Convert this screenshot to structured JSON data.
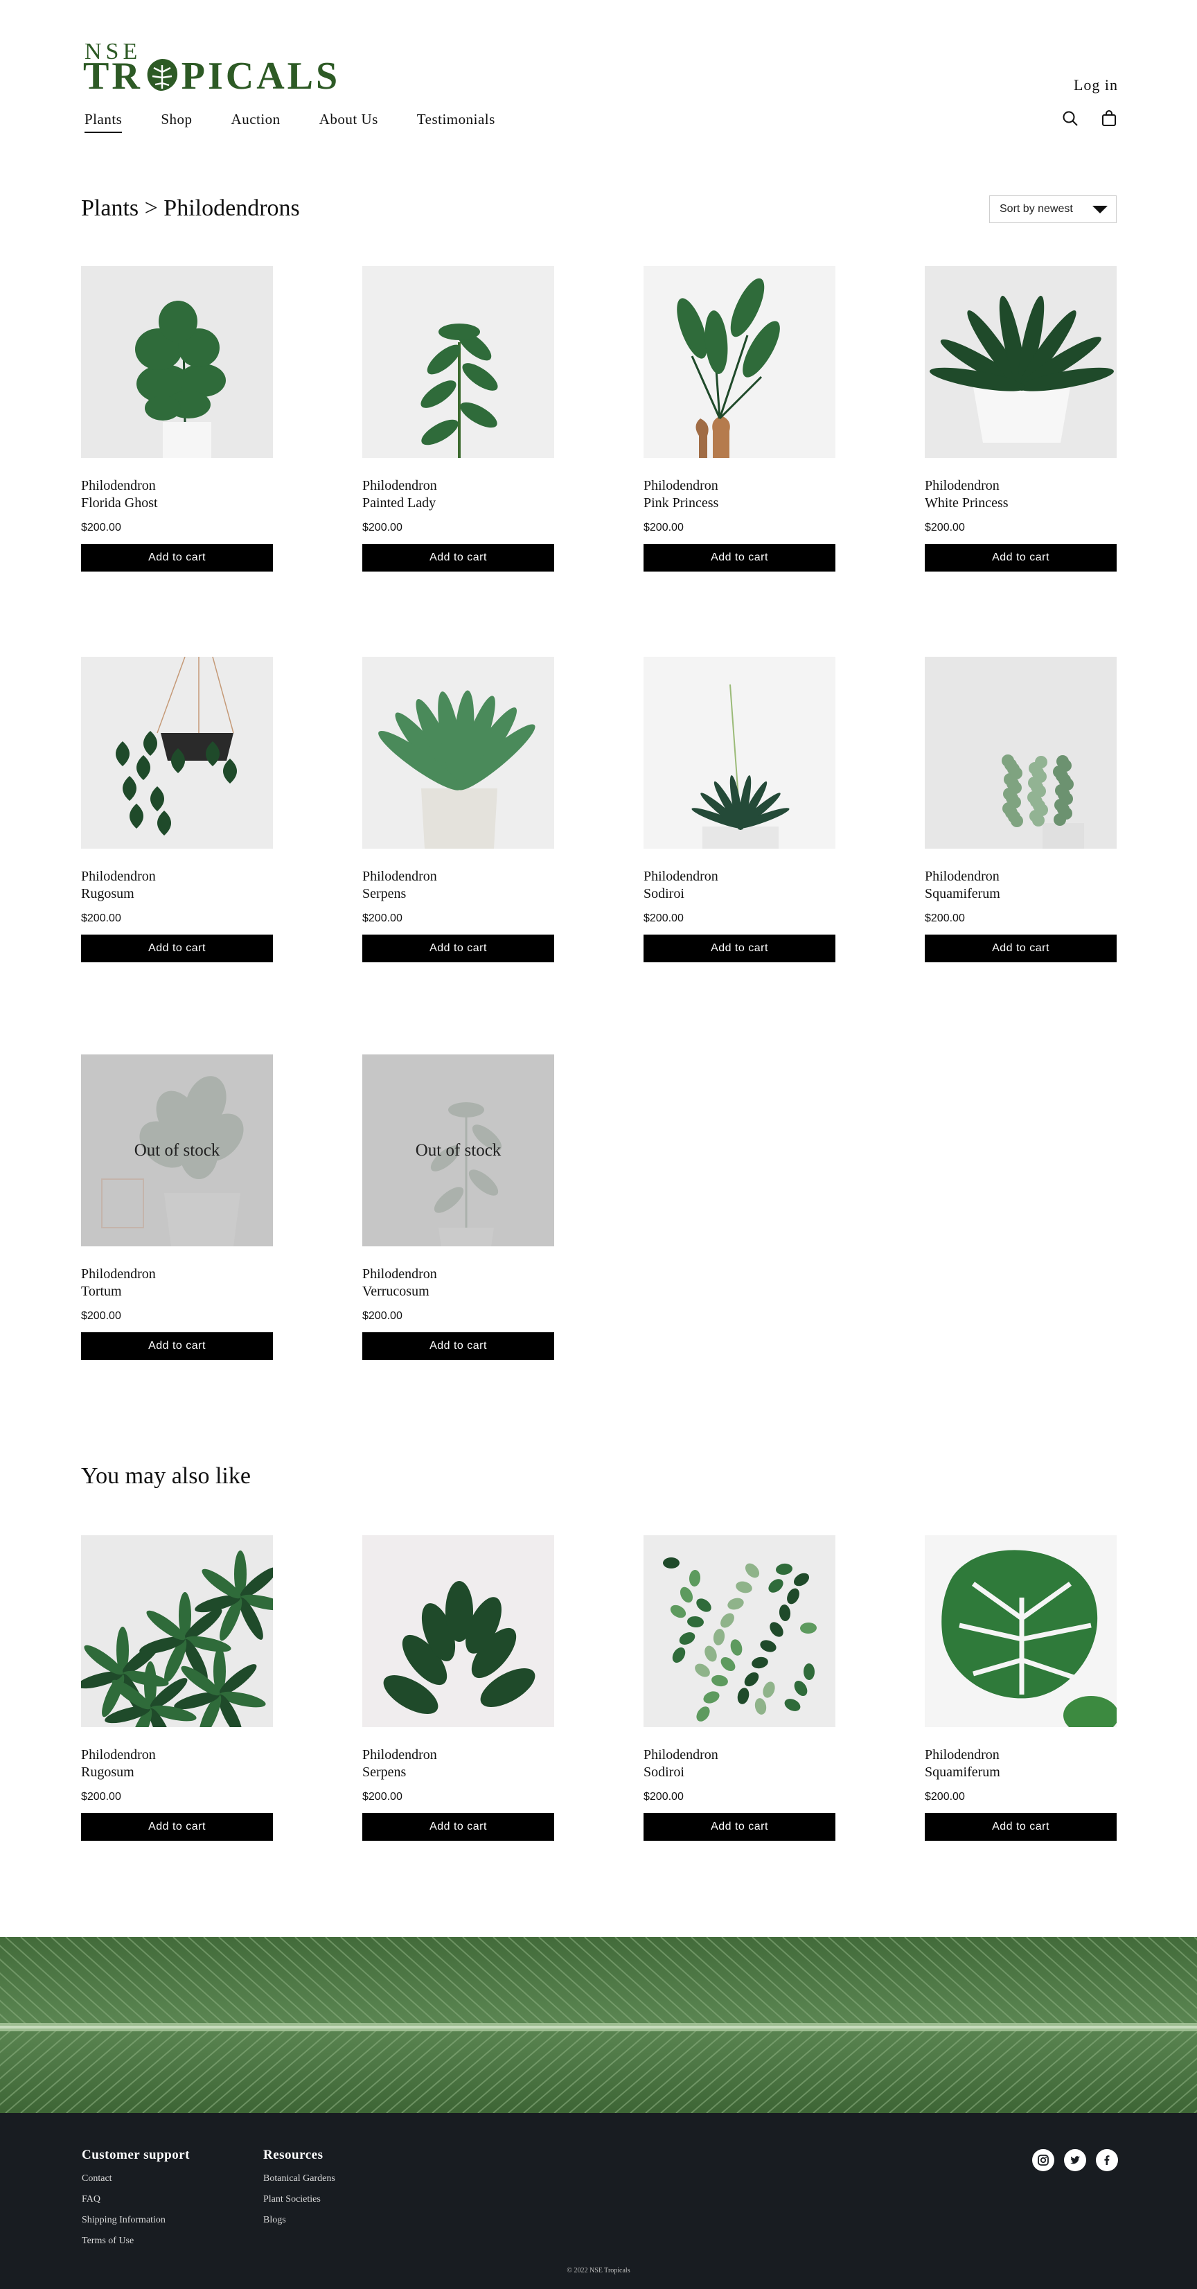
{
  "brand": {
    "top": "NSE",
    "main_prefix": "TR",
    "main_suffix": "PICALS",
    "color": "#2d5a25"
  },
  "header": {
    "login": "Log in",
    "nav": [
      "Plants",
      "Shop",
      "Auction",
      "About Us",
      "Testimonials"
    ],
    "active_nav": "Plants",
    "icons": [
      "search-icon",
      "shopping-bag-icon"
    ]
  },
  "page": {
    "breadcrumb": "Plants > Philodendrons",
    "sort_label": "Sort by newest"
  },
  "products": [
    {
      "genus": "Philodendron",
      "species": "Florida Ghost",
      "price": "$200.00",
      "button": "Add to cart",
      "out_of_stock": false
    },
    {
      "genus": "Philodendron",
      "species": "Painted Lady",
      "price": "$200.00",
      "button": "Add to cart",
      "out_of_stock": false
    },
    {
      "genus": "Philodendron",
      "species": "Pink Princess",
      "price": "$200.00",
      "button": "Add to cart",
      "out_of_stock": false
    },
    {
      "genus": "Philodendron",
      "species": "White Princess",
      "price": "$200.00",
      "button": "Add to cart",
      "out_of_stock": false
    },
    {
      "genus": "Philodendron",
      "species": "Rugosum",
      "price": "$200.00",
      "button": "Add to cart",
      "out_of_stock": false
    },
    {
      "genus": "Philodendron",
      "species": "Serpens",
      "price": "$200.00",
      "button": "Add to cart",
      "out_of_stock": false
    },
    {
      "genus": "Philodendron",
      "species": "Sodiroi",
      "price": "$200.00",
      "button": "Add to cart",
      "out_of_stock": false
    },
    {
      "genus": "Philodendron",
      "species": "Squamiferum",
      "price": "$200.00",
      "button": "Add to cart",
      "out_of_stock": false
    },
    {
      "genus": "Philodendron",
      "species": "Tortum",
      "price": "$200.00",
      "button": "Add to cart",
      "out_of_stock": true,
      "overlay": "Out of stock"
    },
    {
      "genus": "Philodendron",
      "species": "Verrucosum",
      "price": "$200.00",
      "button": "Add to cart",
      "out_of_stock": true,
      "overlay": "Out of stock"
    }
  ],
  "recommendations": {
    "title": "You may also like",
    "items": [
      {
        "genus": "Philodendron",
        "species": "Rugosum",
        "price": "$200.00",
        "button": "Add to cart"
      },
      {
        "genus": "Philodendron",
        "species": "Serpens",
        "price": "$200.00",
        "button": "Add to cart"
      },
      {
        "genus": "Philodendron",
        "species": "Sodiroi",
        "price": "$200.00",
        "button": "Add to cart"
      },
      {
        "genus": "Philodendron",
        "species": "Squamiferum",
        "price": "$200.00",
        "button": "Add to cart"
      }
    ]
  },
  "footer": {
    "customer_support": {
      "title": "Customer support",
      "links": [
        "Contact",
        "FAQ",
        "Shipping Information",
        "Terms of Use"
      ]
    },
    "resources": {
      "title": "Resources",
      "links": [
        "Botanical Gardens",
        "Plant Societies",
        "Blogs"
      ]
    },
    "socials": [
      "instagram-icon",
      "twitter-icon",
      "facebook-icon"
    ],
    "copyright": "© 2022 NSE Tropicals"
  },
  "colors": {
    "button": "#000000",
    "footer_bg": "#181c21",
    "banner_leaf": "#4f7a45"
  }
}
